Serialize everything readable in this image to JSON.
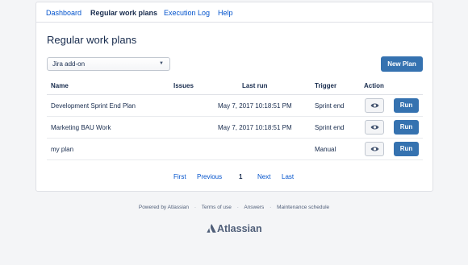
{
  "nav": {
    "tabs": [
      "Dashboard",
      "Regular work plans",
      "Execution Log",
      "Help"
    ],
    "active_tab": "Regular work plans"
  },
  "page": {
    "title": "Regular work plans"
  },
  "filter": {
    "selected": "Jira add-on",
    "icon": "chevron-down-icon"
  },
  "actions": {
    "new_plan": "New Plan"
  },
  "table": {
    "headers": {
      "name": "Name",
      "issues": "Issues",
      "last_run": "Last run",
      "trigger": "Trigger",
      "action": "Action"
    },
    "rows": [
      {
        "name": "Development Sprint End Plan",
        "issues": "",
        "last_run": "May 7, 2017 10:18:51 PM",
        "trigger": "Sprint end",
        "run": "Run"
      },
      {
        "name": "Marketing BAU Work",
        "issues": "",
        "last_run": "May 7, 2017 10:18:51 PM",
        "trigger": "Sprint end",
        "run": "Run"
      },
      {
        "name": "my plan",
        "issues": "",
        "last_run": "",
        "trigger": "Manual",
        "run": "Run"
      }
    ],
    "view_icon": "eye-icon"
  },
  "pagination": {
    "first": "First",
    "previous": "Previous",
    "current": "1",
    "next": "Next",
    "last": "Last"
  },
  "footer": {
    "powered_by": "Powered by Atlassian",
    "links": [
      "Terms of use",
      "Answers",
      "Maintenance schedule"
    ],
    "logo_text": "Atlassian",
    "separator": "·"
  },
  "colors": {
    "primary_button": "#3572b0",
    "link": "#0052cc",
    "background": "#f4f5f7"
  }
}
